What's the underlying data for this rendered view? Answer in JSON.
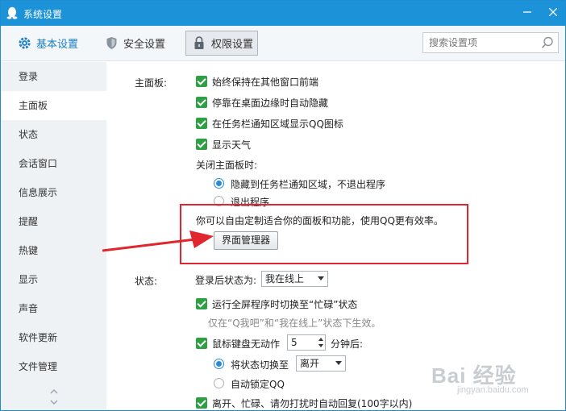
{
  "window": {
    "title": "系统设置",
    "brand_color": "#1c92d9"
  },
  "toolbar": {
    "tabs": [
      {
        "label": "基本设置",
        "icon": "gear-icon"
      },
      {
        "label": "安全设置",
        "icon": "shield-icon"
      },
      {
        "label": "权限设置",
        "icon": "lock-icon"
      }
    ],
    "search_placeholder": "搜索设置项"
  },
  "sidebar": {
    "items": [
      {
        "label": "登录"
      },
      {
        "label": "主面板"
      },
      {
        "label": "状态"
      },
      {
        "label": "会话窗口"
      },
      {
        "label": "信息展示"
      },
      {
        "label": "提醒"
      },
      {
        "label": "热键"
      },
      {
        "label": "显示"
      },
      {
        "label": "声音"
      },
      {
        "label": "软件更新"
      },
      {
        "label": "文件管理"
      }
    ]
  },
  "main_panel": {
    "section_label": "主面板:",
    "options": [
      {
        "label": "始终保持在其他窗口前端",
        "checked": true
      },
      {
        "label": "停靠在桌面边缘时自动隐藏",
        "checked": true
      },
      {
        "label": "在任务栏通知区域显示QQ图标",
        "checked": true
      },
      {
        "label": "显示天气",
        "checked": true
      }
    ],
    "close_label": "关闭主面板时:",
    "close_options": [
      {
        "label": "隐藏到任务栏通知区域，不退出程序",
        "selected": true
      },
      {
        "label": "退出程序",
        "selected": false
      }
    ],
    "custom_hint": "你可以自由定制适合你的面板和功能，使用QQ更有效率。",
    "manager_button": "界面管理器"
  },
  "status": {
    "section_label": "状态:",
    "after_login_label": "登录后状态为:",
    "after_login_value": "我在线上",
    "fullscreen_option": {
      "label": "运行全屏程序时切换至“忙碌”状态",
      "checked": true
    },
    "fullscreen_note": "仅在“Q我吧”和“我在线上”状态下生效。",
    "idle_option": {
      "label": "鼠标键盘无动作",
      "checked": true
    },
    "idle_minutes": "5",
    "idle_suffix": "分钟后:",
    "idle_actions": [
      {
        "label": "将状态切换至",
        "selected": true
      },
      {
        "label": "自动锁定QQ",
        "selected": false
      }
    ],
    "idle_status_value": "离开",
    "auto_reply_option": {
      "label": "离开、忙碌、请勿打扰时自动回复(100字以内)",
      "checked": true
    }
  },
  "watermark": {
    "main": "Bai 经验",
    "sub": "jingyan.baidu.com"
  },
  "colors": {
    "accent": "#1c7fc7",
    "check_green": "#2ea043",
    "highlight_red": "#e0262e"
  }
}
